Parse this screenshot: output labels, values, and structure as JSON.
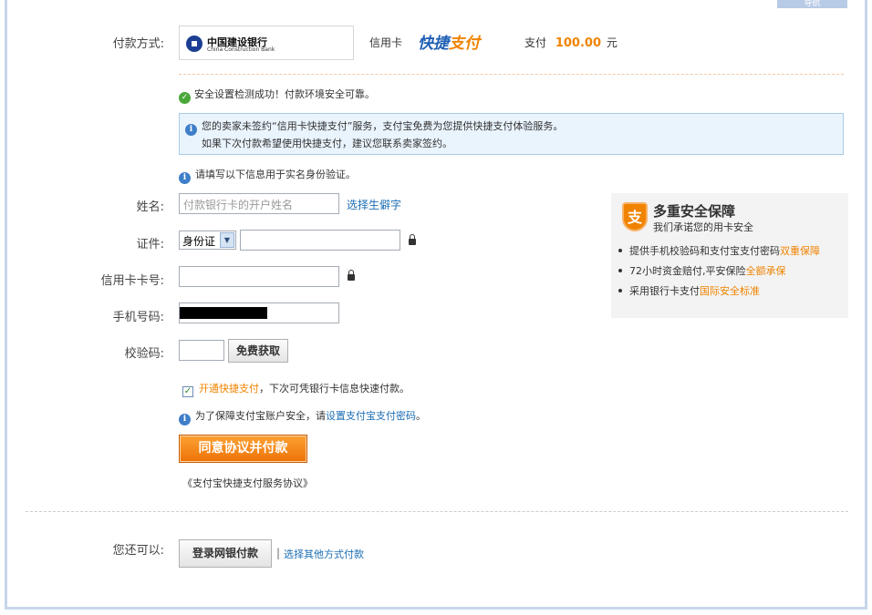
{
  "header": {
    "corner_tab": "导航",
    "method_label": "付款方式:",
    "bank_name_cn": "中国建设银行",
    "bank_name_en": "China Construction Bank",
    "card_type": "信用卡",
    "kuaijie_part1": "快捷",
    "kuaijie_part2": "支付",
    "pay_label": "支付",
    "amount": "100.00",
    "currency": "元"
  },
  "status": {
    "security_ok": "安全设置检测成功！付款环境安全可靠。",
    "notice_line1": "您的卖家未签约“信用卡快捷支付”服务，支付宝免费为您提供快捷支付体验服务。",
    "notice_line2": "如果下次付款希望使用快捷支付，建议您联系卖家签约。",
    "realname_hint": "请填写以下信息用于实名身份验证。"
  },
  "form": {
    "name_label": "姓名:",
    "name_placeholder": "付款银行卡的开户姓名",
    "rare_char_link": "选择生僻字",
    "id_label": "证件:",
    "id_type": "身份证",
    "card_label": "信用卡卡号:",
    "phone_label": "手机号码:",
    "code_label": "校验码:",
    "get_code_button": "免费获取",
    "enable_link": "开通快捷支付",
    "enable_text": "，下次可凭银行卡信息快速付款。",
    "pwd_hint_prefix": "为了保障支付宝账户安全，请",
    "pwd_link": "设置支付宝支付密码",
    "pwd_hint_suffix": "。",
    "submit_button": "同意协议并付款",
    "agreement_link": "《支付宝快捷支付服务协议》"
  },
  "promo": {
    "shield_glyph": "支",
    "title": "多重安全保障",
    "subtitle": "我们承诺您的用卡安全",
    "items": [
      {
        "text": "提供手机校验码和支付宝支付密码",
        "highlight": "双重保障"
      },
      {
        "text": "72小时资金赔付,平安保险",
        "highlight": "全额承保"
      },
      {
        "text": "采用银行卡支付",
        "highlight": "国际安全标准"
      }
    ]
  },
  "footer": {
    "also_label": "您还可以:",
    "netbank_button": "登录网银付款",
    "separator": "|",
    "other_methods_link": "选择其他方式付款"
  },
  "colors": {
    "accent_orange": "#f08300",
    "link_blue": "#1b6db3",
    "frame_border": "#c8d6ea"
  }
}
